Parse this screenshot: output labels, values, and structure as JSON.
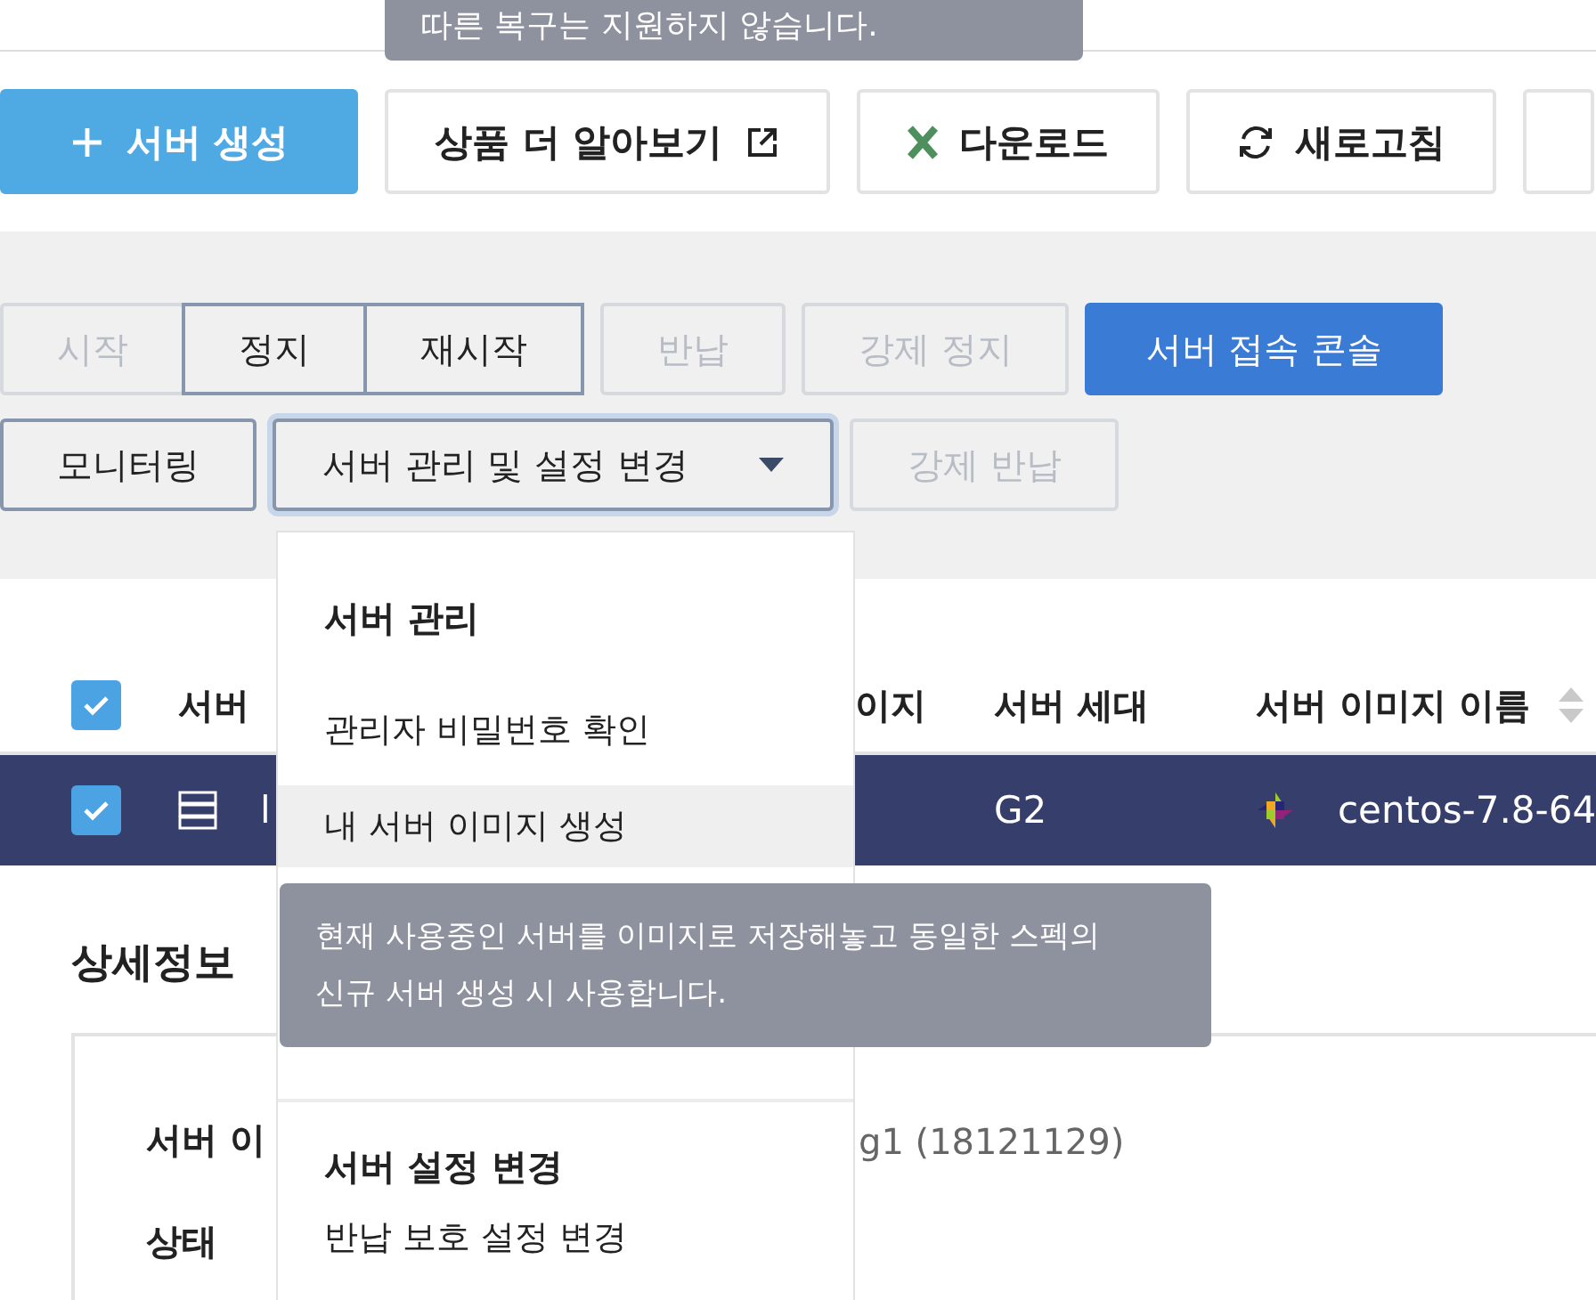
{
  "top_tooltip": {
    "text": "따른 복구는 지원하지 않습니다."
  },
  "toolbar": [
    {
      "label": "서버 생성",
      "kind": "create"
    },
    {
      "label": "상품 더 알아보기",
      "kind": "external"
    },
    {
      "label": "다운로드",
      "kind": "excel"
    },
    {
      "label": "새로고침",
      "kind": "refresh"
    },
    {
      "kind": "partial"
    }
  ],
  "action_rows": [
    [
      {
        "label": "시작",
        "kind": "button",
        "disabled": true,
        "joined": false
      },
      {
        "label": "정지",
        "kind": "button",
        "disabled": false,
        "joined": true
      },
      {
        "label": "재시작",
        "kind": "button",
        "disabled": false,
        "joined": true
      },
      {
        "label": "반납",
        "kind": "button",
        "disabled": true,
        "joined": false
      },
      {
        "label": "강제 정지",
        "kind": "button",
        "disabled": true,
        "joined": false
      },
      {
        "label": "서버 접속 콘솔",
        "kind": "primary",
        "disabled": false,
        "joined": false
      }
    ],
    [
      {
        "label": "모니터링",
        "kind": "button",
        "disabled": false,
        "joined": false
      },
      {
        "label": "서버 관리 및 설정 변경",
        "kind": "dropdown",
        "disabled": false,
        "joined": false,
        "expanded": true
      },
      {
        "label": "강제 반납",
        "kind": "button",
        "disabled": true,
        "joined": false
      }
    ]
  ],
  "table": {
    "header_checked": true,
    "columns": [
      {
        "label": "서버"
      },
      {
        "label": "이지"
      },
      {
        "label": "서버 세대"
      },
      {
        "label": "서버 이미지 이름",
        "sortable": true
      }
    ],
    "rows": [
      {
        "selected": true,
        "checked": true,
        "name": "l",
        "generation": "G2",
        "image": "centos-7.8-64"
      }
    ]
  },
  "details": {
    "title": "상세정보",
    "fields": [
      {
        "label": "서버 이",
        "value": "g1 (18121129)"
      },
      {
        "label": "상태"
      }
    ]
  },
  "menu": {
    "sections": [
      {
        "title": "서버 관리",
        "items": [
          {
            "label": "관리자 비밀번호 확인",
            "selected": false
          },
          {
            "label": "내 서버 이미지 생성",
            "selected": true
          }
        ]
      },
      {
        "title": "서버 설정 변경",
        "items": [
          {
            "label": "반납 보호 설정 변경",
            "selected": false
          }
        ]
      }
    ]
  },
  "item_tooltip": {
    "text": "현재 사용중인 서버를 이미지로 저장해놓고 동일한 스펙의 신규 서버 생성 시 사용합니다."
  }
}
